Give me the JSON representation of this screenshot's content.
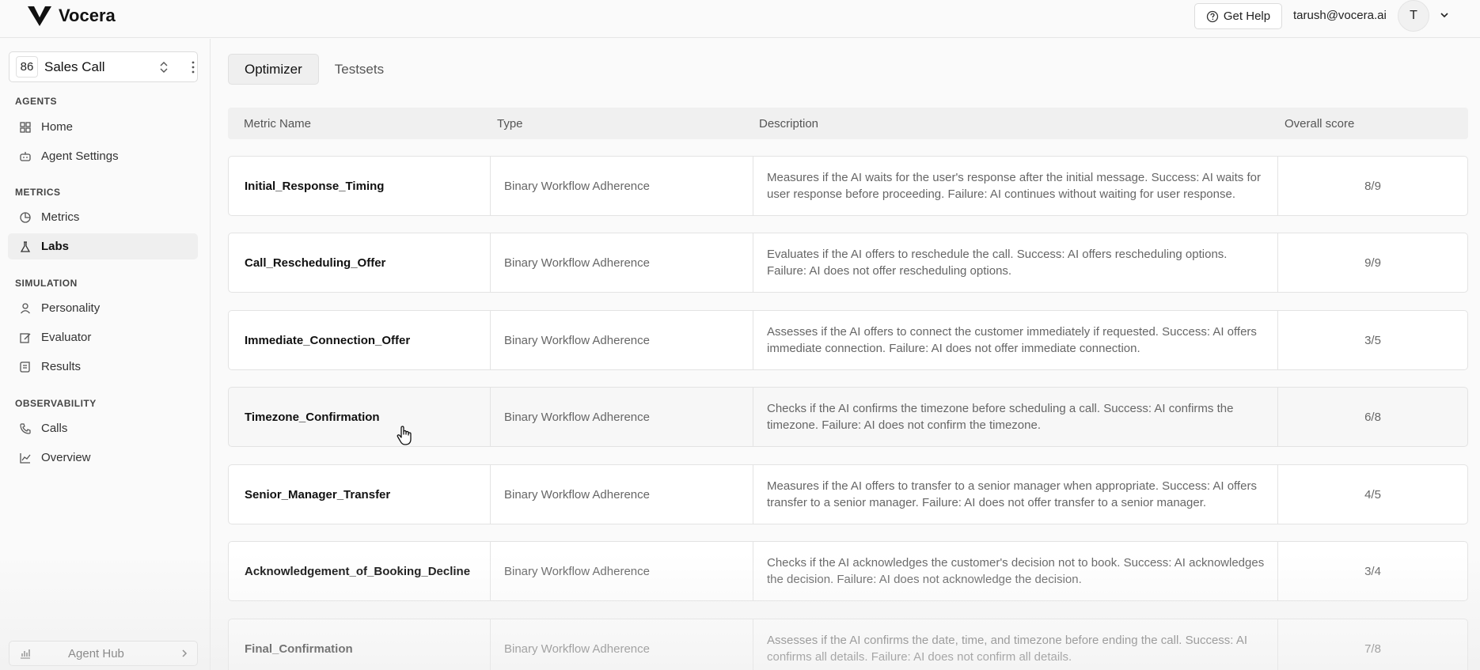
{
  "app": {
    "name": "Vocera"
  },
  "header": {
    "help_label": "Get Help",
    "user_email": "tarush@vocera.ai",
    "avatar_initial": "T"
  },
  "sidebar": {
    "agent": {
      "id": "86",
      "name": "Sales Call"
    },
    "sections": [
      {
        "label": "AGENTS",
        "items": [
          {
            "label": "Home",
            "icon": "grid-icon"
          },
          {
            "label": "Agent Settings",
            "icon": "bot-icon"
          }
        ]
      },
      {
        "label": "METRICS",
        "items": [
          {
            "label": "Metrics",
            "icon": "pie-chart-icon"
          },
          {
            "label": "Labs",
            "icon": "flask-icon",
            "active": true
          }
        ]
      },
      {
        "label": "SIMULATION",
        "items": [
          {
            "label": "Personality",
            "icon": "user-icon"
          },
          {
            "label": "Evaluator",
            "icon": "evaluator-icon"
          },
          {
            "label": "Results",
            "icon": "scroll-icon"
          }
        ]
      },
      {
        "label": "OBSERVABILITY",
        "items": [
          {
            "label": "Calls",
            "icon": "phone-icon"
          },
          {
            "label": "Overview",
            "icon": "line-chart-icon"
          }
        ]
      }
    ],
    "hub_label": "Agent Hub"
  },
  "main": {
    "tabs": [
      {
        "label": "Optimizer",
        "active": true
      },
      {
        "label": "Testsets"
      }
    ],
    "table": {
      "headers": {
        "name": "Metric Name",
        "type": "Type",
        "description": "Description",
        "score": "Overall score"
      },
      "rows": [
        {
          "name": "Initial_Response_Timing",
          "type": "Binary Workflow Adherence",
          "description": "Measures if the AI waits for the user's response after the initial message. Success: AI waits for user response before proceeding. Failure: AI continues without waiting for user response.",
          "score": "8/9"
        },
        {
          "name": "Call_Rescheduling_Offer",
          "type": "Binary Workflow Adherence",
          "description": "Evaluates if the AI offers to reschedule the call. Success: AI offers rescheduling options. Failure: AI does not offer rescheduling options.",
          "score": "9/9"
        },
        {
          "name": "Immediate_Connection_Offer",
          "type": "Binary Workflow Adherence",
          "description": "Assesses if the AI offers to connect the customer immediately if requested. Success: AI offers immediate connection. Failure: AI does not offer immediate connection.",
          "score": "3/5"
        },
        {
          "name": "Timezone_Confirmation",
          "type": "Binary Workflow Adherence",
          "description": "Checks if the AI confirms the timezone before scheduling a call. Success: AI confirms the timezone. Failure: AI does not confirm the timezone.",
          "score": "6/8"
        },
        {
          "name": "Senior_Manager_Transfer",
          "type": "Binary Workflow Adherence",
          "description": "Measures if the AI offers to transfer to a senior manager when appropriate. Success: AI offers transfer to a senior manager. Failure: AI does not offer transfer to a senior manager.",
          "score": "4/5"
        },
        {
          "name": "Acknowledgement_of_Booking_Decline",
          "type": "Binary Workflow Adherence",
          "description": "Checks if the AI acknowledges the customer's decision not to book. Success: AI acknowledges the decision. Failure: AI does not acknowledge the decision.",
          "score": "3/4"
        },
        {
          "name": "Final_Confirmation",
          "type": "Binary Workflow Adherence",
          "description": "Assesses if the AI confirms the date, time, and timezone before ending the call. Success: AI confirms all details. Failure: AI does not confirm all details.",
          "score": "7/8"
        }
      ]
    }
  }
}
